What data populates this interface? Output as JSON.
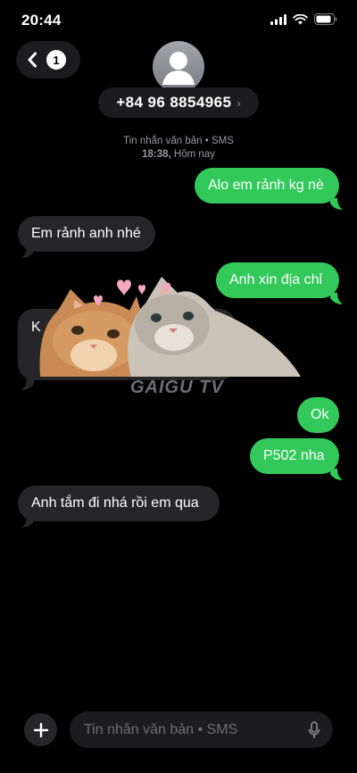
{
  "status": {
    "time": "20:44"
  },
  "header": {
    "back_badge": "1",
    "contact_name": "+84 96 8854965"
  },
  "meta": {
    "line1": "Tin nhắn văn bản • SMS",
    "line2_time": "18:38,",
    "line2_day": "Hôm nay"
  },
  "messages": [
    {
      "from": "me",
      "text": "Alo em rảnh kg nè"
    },
    {
      "from": "them",
      "text": "Em rảnh anh nhé"
    },
    {
      "from": "me",
      "text": "Anh xin địa chỉ"
    },
    {
      "from": "them",
      "text": "K",
      "obscured": true
    },
    {
      "from": "me",
      "text": "Ok"
    },
    {
      "from": "me",
      "text": "P502 nha"
    },
    {
      "from": "them",
      "text": "Anh tắm đi nhá rồi em qua"
    }
  ],
  "sticker": {
    "name": "two-cats-hearts",
    "watermark": "GAIGU TV"
  },
  "composer": {
    "placeholder": "Tin nhắn văn bản • SMS"
  },
  "colors": {
    "outgoing": "#32c95a",
    "incoming": "#262628",
    "background": "#000000"
  }
}
